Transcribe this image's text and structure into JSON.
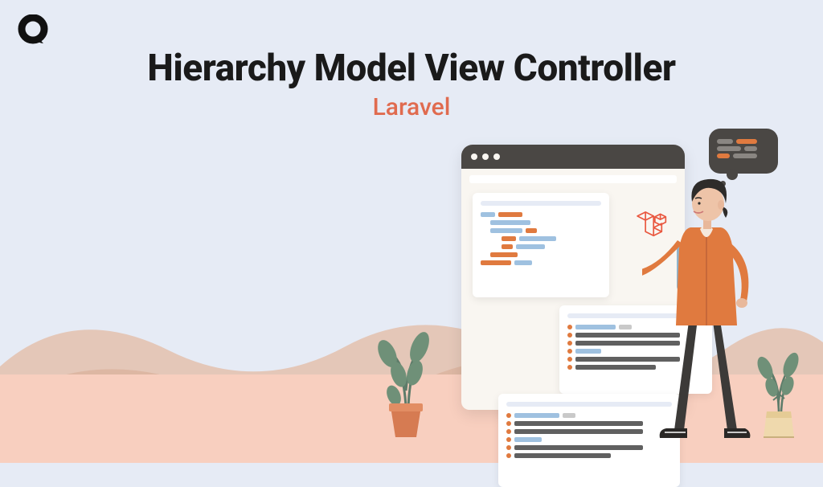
{
  "title": "Hierarchy Model View Controller",
  "subtitle": "Laravel",
  "colors": {
    "bg": "#E6EBF5",
    "accent": "#E06B4F",
    "dark": "#1a1a1a",
    "hill_back": "#E4C7B8",
    "hill_front": "#DDB7A3",
    "ground": "#F8CFBF",
    "browser_bar": "#4A4744",
    "jacket": "#E07A3F"
  },
  "icons": {
    "logo": "logo-mark",
    "laravel": "laravel-icon",
    "speech": "speech-bubble-icon",
    "plant1": "plant-icon",
    "plant2": "plant-icon"
  }
}
